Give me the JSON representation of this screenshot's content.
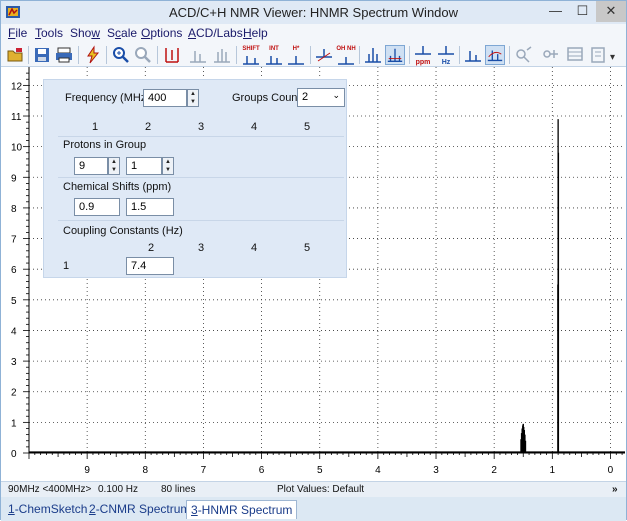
{
  "window": {
    "title": "ACD/C+H NMR Viewer: HNMR Spectrum Window",
    "min_glyph": "—",
    "max_glyph": "☐",
    "close_glyph": "✕"
  },
  "menu": [
    {
      "label": "File",
      "key": "F"
    },
    {
      "label": "Tools",
      "key": "T"
    },
    {
      "label": "Show",
      "key": "w"
    },
    {
      "label": "Scale",
      "key": "c"
    },
    {
      "label": "Options",
      "key": "O"
    },
    {
      "label": "ACD/Labs",
      "key": "A"
    },
    {
      "label": "Help",
      "key": "H"
    }
  ],
  "toolbar": {
    "shift_label": "SHIFT",
    "int_label": "INT",
    "ppm_label": "ppm",
    "hz_label": "Hz",
    "oh_label": "OH NH",
    "nh_label": "H*"
  },
  "panel": {
    "frequency_label": "Frequency (MHz) :",
    "frequency_value": "400",
    "groups_count_label": "Groups Count :",
    "groups_count_value": "2",
    "group_headers": [
      "1",
      "2",
      "3",
      "4",
      "5"
    ],
    "protons_label": "Protons in Group",
    "protons_values": [
      "9",
      "1"
    ],
    "shifts_label": "Chemical Shifts (ppm)",
    "shifts_values": [
      "0.9",
      "1.5"
    ],
    "coupling_label": "Coupling Constants (Hz)",
    "coupling_headers": [
      "2",
      "3",
      "4",
      "5"
    ],
    "coupling_row_label": "1",
    "coupling_value": "7.4"
  },
  "chart_data": {
    "type": "line",
    "xlabel": "",
    "ylabel": "",
    "x_ticks": [
      "9",
      "8",
      "7",
      "6",
      "5",
      "4",
      "3",
      "2",
      "1",
      "0"
    ],
    "y_ticks": [
      "0",
      "1",
      "2",
      "3",
      "4",
      "5",
      "6",
      "7",
      "8",
      "9",
      "10",
      "11",
      "12"
    ],
    "xlim": [
      10.0,
      -0.25
    ],
    "ylim": [
      0,
      12.6
    ],
    "peaks": [
      {
        "shift": 0.9,
        "height": 10.9,
        "note": "singlet 9H"
      },
      {
        "shift": 0.905,
        "height": 5.5
      },
      {
        "shift": 0.895,
        "height": 9.8
      },
      {
        "shift": 1.5,
        "height": 0.95,
        "note": "multiplet 1H"
      }
    ],
    "multiplet": [
      [
        1.46,
        0.4
      ],
      [
        1.47,
        0.6
      ],
      [
        1.48,
        0.75
      ],
      [
        1.49,
        0.85
      ],
      [
        1.5,
        0.95
      ],
      [
        1.51,
        0.9
      ],
      [
        1.52,
        0.8
      ],
      [
        1.53,
        0.65
      ],
      [
        1.54,
        0.45
      ]
    ],
    "grid": true
  },
  "status": {
    "freq_info": "90MHz <400MHz>",
    "hz_info": "0.100 Hz",
    "lines_info": "80 lines",
    "plot_values": "Plot Values: Default",
    "more": "»"
  },
  "tabs": [
    {
      "label": "1-ChemSketch",
      "active": false
    },
    {
      "label": "2-CNMR Spectrum",
      "active": false
    },
    {
      "label": "3-HNMR Spectrum",
      "active": true
    }
  ]
}
